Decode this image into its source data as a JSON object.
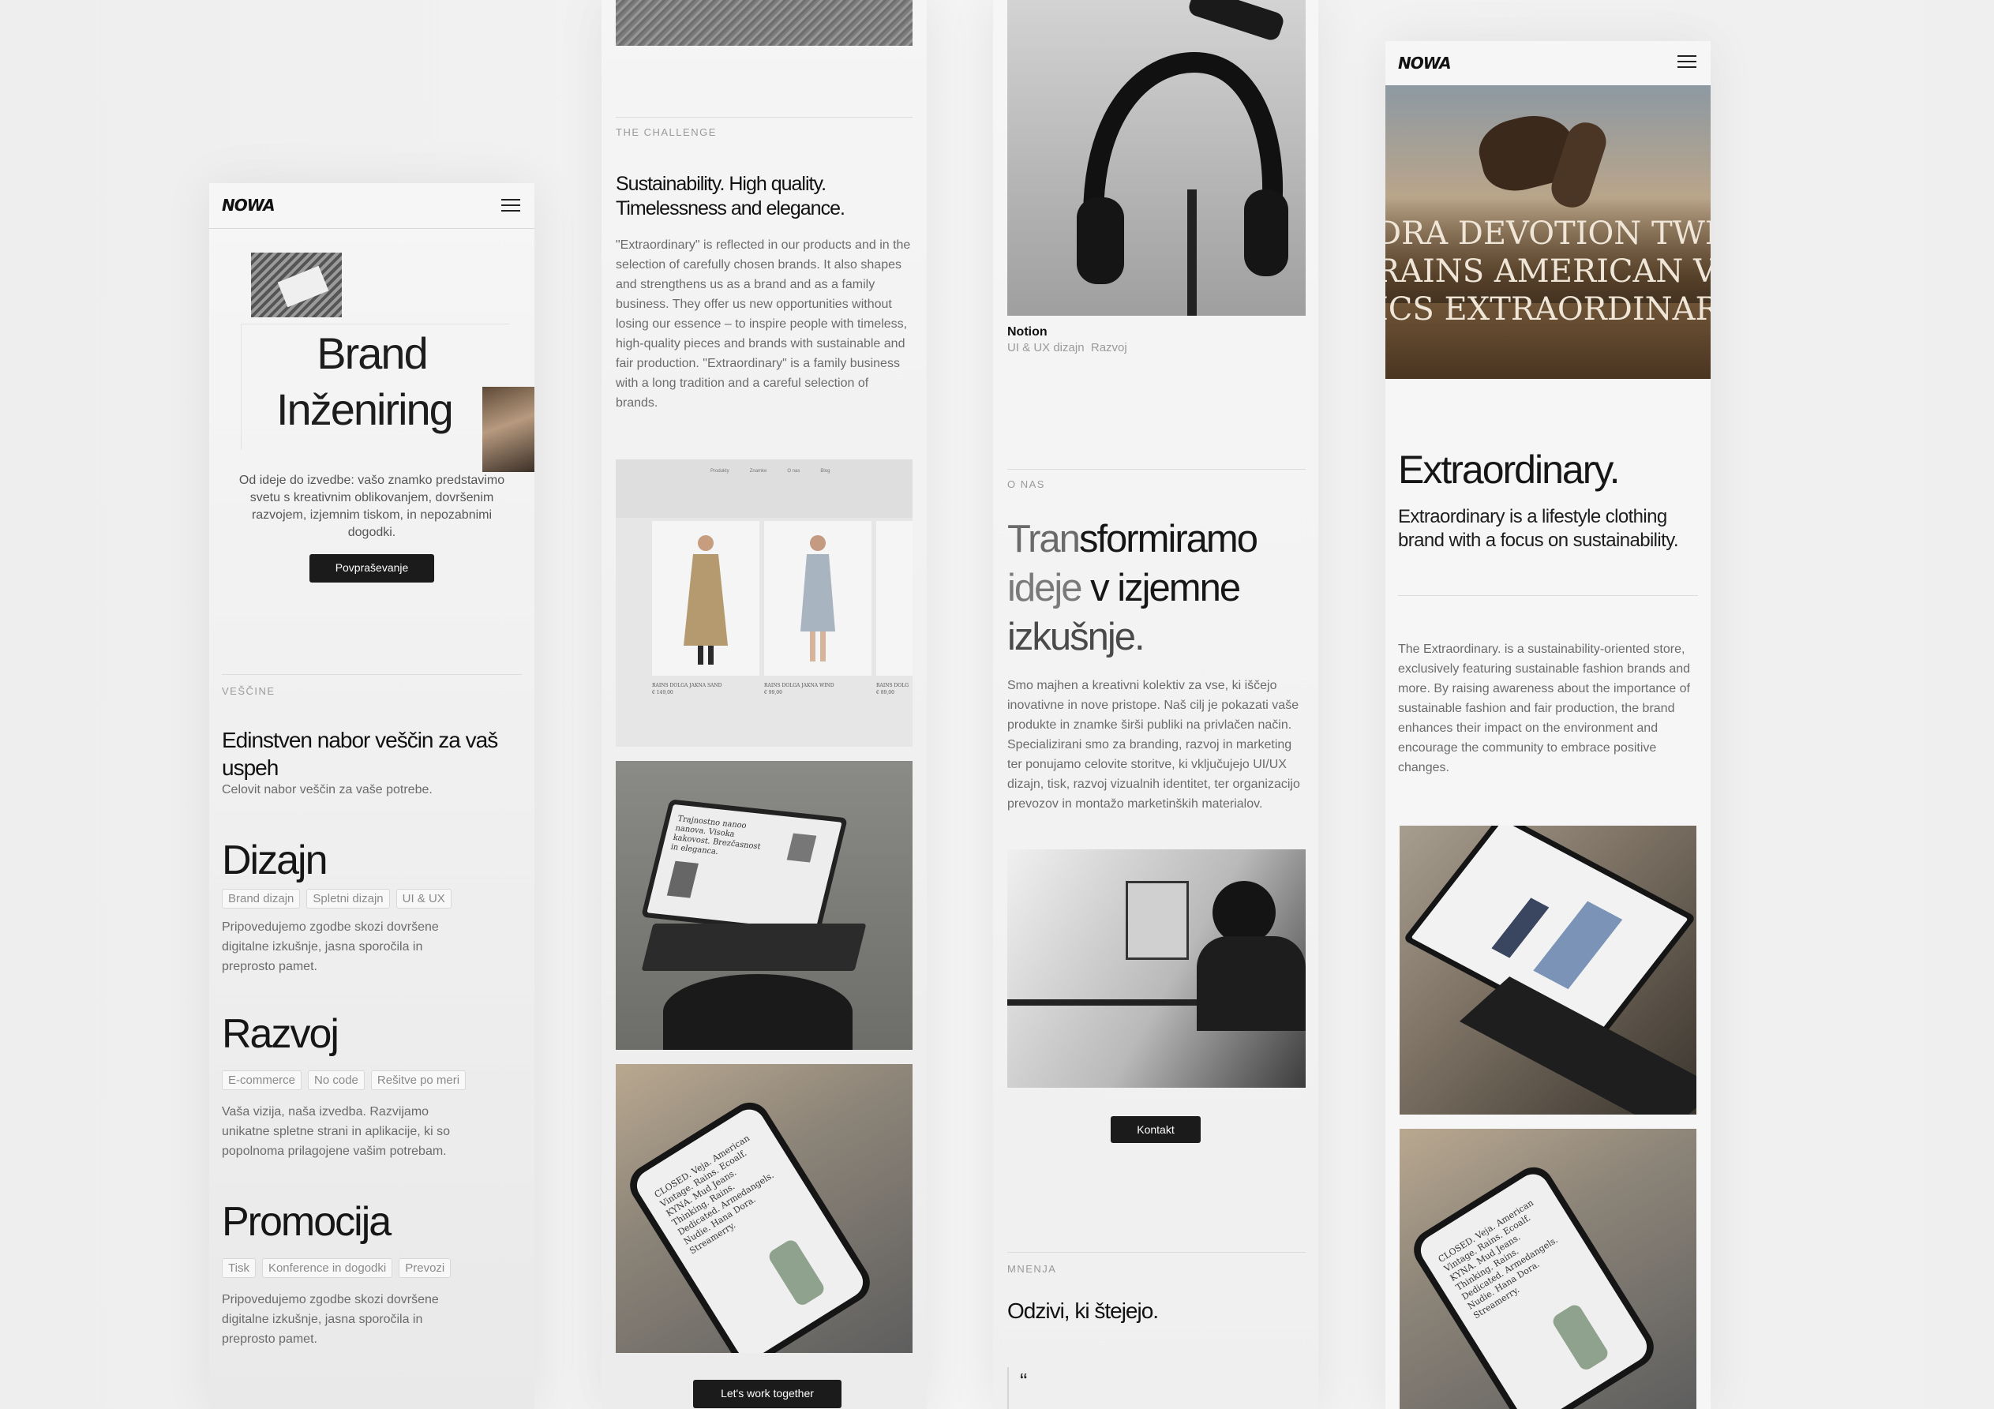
{
  "brand": {
    "logo": "NOWA"
  },
  "col1": {
    "hero_line1": "Brand",
    "hero_line2": "Inženiring",
    "hero_desc": "Od ideje do izvedbe: vašo znamko predstavimo svetu s kreativnim oblikovanjem, dovršenim razvojem, izjemnim tiskom, in nepozabnimi dogodki.",
    "cta": "Povpraševanje",
    "skills_label": "VEŠČINE",
    "skills_title": "Edinstven nabor veščin za vaš uspeh",
    "skills_sub": "Celovit nabor veščin za vaše potrebe.",
    "services": [
      {
        "title": "Dizajn",
        "tags": [
          "Brand dizajn",
          "Spletni dizajn",
          "UI & UX"
        ],
        "desc": "Pripovedujemo zgodbe skozi dovršene digitalne izkušnje, jasna sporočila in preprosto pamet."
      },
      {
        "title": "Razvoj",
        "tags": [
          "E-commerce",
          "No code",
          "Rešitve po meri"
        ],
        "desc": "Vaša vizija, naša izvedba. Razvijamo unikatne spletne strani in aplikacije, ki so popolnoma prilagojene vašim potrebam."
      },
      {
        "title": "Promocija",
        "tags": [
          "Tisk",
          "Konference in dogodki",
          "Prevozi"
        ],
        "desc": "Pripovedujemo zgodbe skozi dovršene digitalne izkušnje, jasna sporočila in preprosto pamet."
      }
    ]
  },
  "col2": {
    "challenge_label": "THE CHALLENGE",
    "challenge_title": "Sustainability. High quality. Timelessness and elegance.",
    "challenge_body": "\"Extraordinary\" is reflected in our products and in the selection of carefully chosen brands. It also shapes and strengthens us as a brand and as a family business. They offer us new opportunities without losing our essence – to inspire people with timeless, high-quality pieces and brands with sustainable and fair production. \"Extraordinary\" is a family business with a long tradition and a careful selection of brands.",
    "cta": "Let's work together"
  },
  "col3": {
    "project_name": "Notion",
    "project_tags": "UI & UX dizajn  Razvoj",
    "about_label": "O NAS",
    "about_title_a": "Tran",
    "about_title_b": "sformiramo",
    "about_title_c": "ideje",
    "about_title_d": " v izjemne",
    "about_title_e": "izkušnje.",
    "about_body": "Smo majhen a kreativni kolektiv za vse, ki iščejo inovativne in nove pristope. Naš cilj je pokazati vaše produkte in znamke širši publiki na privlačen način. Specializirani smo za branding, razvoj in marketing ter ponujamo celovite storitve, ki vključujejo UI/UX dizajn, tisk, razvoj vizualnih identitet, ter organizacijo prevozov in montažo marketinških materialov.",
    "cta": "Kontakt",
    "reviews_label": "MNENJA",
    "reviews_title": "Odzivi, ki štejejo.",
    "quote_mark": "“"
  },
  "col4": {
    "banner_lines": [
      "DRA DEVOTION TWIN",
      "RAINS AMERICAN VIN",
      "ICS EXTRAORDINARY"
    ],
    "title": "Extraordinary.",
    "subtitle": "Extraordinary is a lifestyle clothing brand with a focus on sustainability.",
    "body": "The Extraordinary. is a sustainability-oriented store, exclusively featuring sustainable fashion brands and more. By raising awareness about the importance of sustainable fashion and fair production, the brand enhances their impact on the environment and encourage the community to embrace positive changes."
  },
  "mockups": {
    "laptop_headline": "Trajnostno nanoo nanova. Visoka kakovost. Brezčasnost in eleganca.",
    "phone_text": "CLOSED. Vejа. American Vintage. Rains. Ecoalf. KYNA. Mud Jeans. Thinking. Rains. Dedicated. Armedangels. Nudie. Hana Dora. Streamerry.",
    "shop_nav": [
      "Produkty",
      "Znamke",
      "O nas",
      "Blog"
    ],
    "shop_products": [
      {
        "name": "RAINS DOLGA JAKNA SAND",
        "price": "€ 149,00"
      },
      {
        "name": "RAINS DOLGA JAKNA WIND",
        "price": "€ 99,00"
      },
      {
        "name": "RAINS DOLG",
        "price": "€ 89,00"
      }
    ]
  },
  "colors": {
    "dark": "#1b1b1b",
    "muted": "#6b6b6b",
    "label": "#9a9a9a",
    "bg": "#f3f3f3"
  }
}
